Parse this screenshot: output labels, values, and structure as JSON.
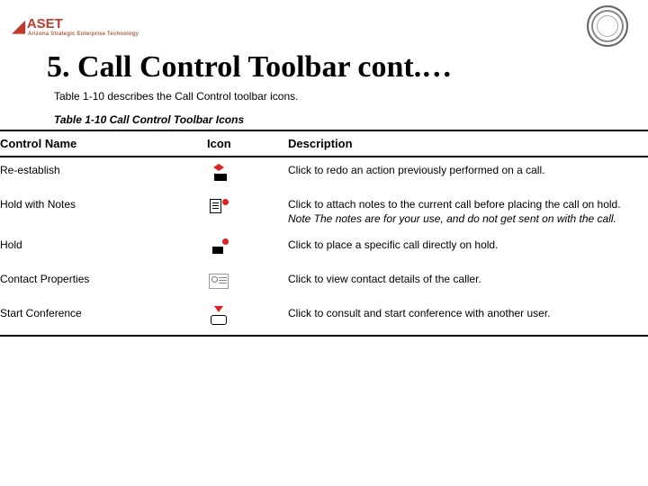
{
  "brand": {
    "mark": "◢",
    "name": "ASET",
    "tag": "Arizona Strategic Enterprise Technology"
  },
  "title": "5. Call Control Toolbar cont.…",
  "intro": "Table 1-10 describes the Call Control toolbar icons.",
  "caption": "Table 1-10 Call Control Toolbar Icons",
  "columns": {
    "c1": "Control Name",
    "c2": "Icon",
    "c3": "Description"
  },
  "rows": [
    {
      "name": "Re-establish",
      "icon": "reestablish-icon",
      "desc": "Click to redo an action previously performed on a call."
    },
    {
      "name": "Hold with Notes",
      "icon": "hold-with-notes-icon",
      "desc": "Click to attach notes to the current call before placing the call on hold. ",
      "desc_note": "Note The notes are for your use, and do not get sent on with the call."
    },
    {
      "name": "Hold",
      "icon": "hold-icon",
      "desc": "Click to place a specific call directly on hold."
    },
    {
      "name": "Contact Properties",
      "icon": "contact-properties-icon",
      "desc": "Click to view contact details of the caller."
    },
    {
      "name": "Start Conference",
      "icon": "start-conference-icon",
      "desc": "Click to consult and start conference with another user."
    }
  ]
}
